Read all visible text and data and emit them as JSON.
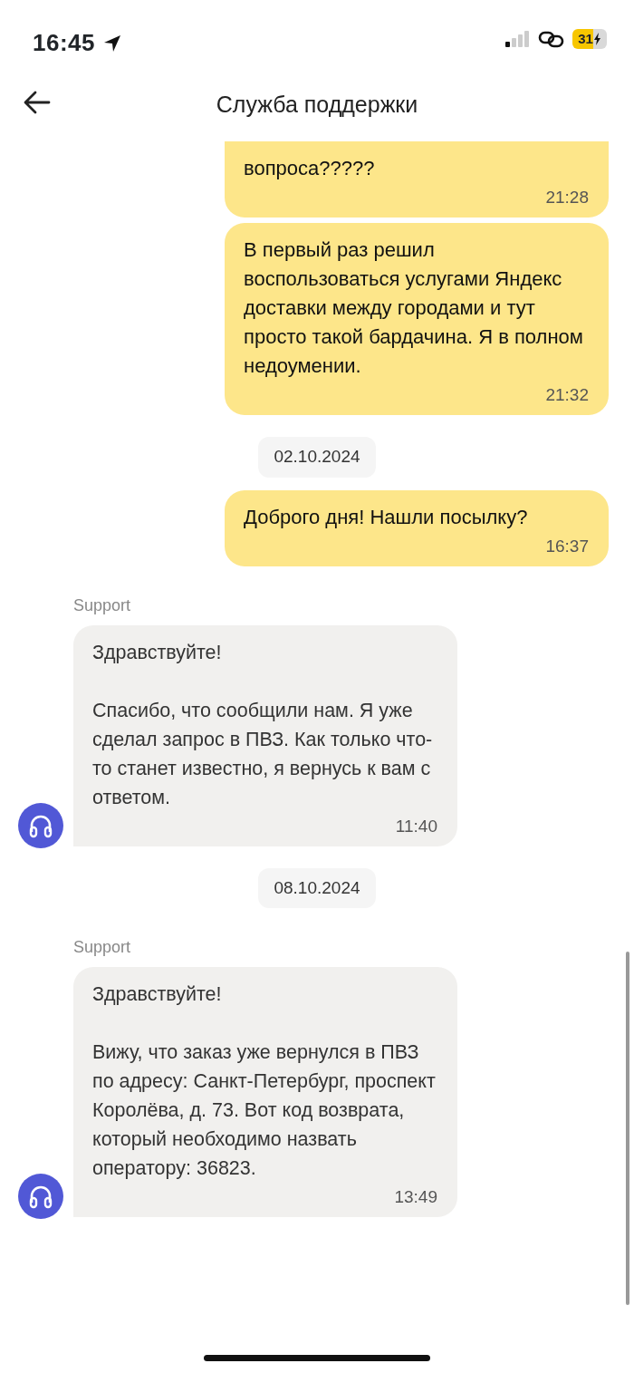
{
  "status_bar": {
    "time": "16:45",
    "battery": "31"
  },
  "header": {
    "title": "Служба поддержки"
  },
  "messages": [
    {
      "kind": "outgoing",
      "text": "вопроса?????",
      "time": "21:28",
      "cut_top": true
    },
    {
      "kind": "outgoing",
      "text": "В первый раз решил воспользоваться услугами Яндекс доставки между городами и тут просто такой бардачина. Я в полном недоумении.",
      "time": "21:32"
    },
    {
      "kind": "date",
      "text": "02.10.2024"
    },
    {
      "kind": "outgoing",
      "text": "Доброго дня! Нашли посылку?",
      "time": "16:37"
    },
    {
      "kind": "incoming",
      "sender": "Support",
      "text": "Здравствуйте!\n\nСпасибо, что сообщили нам. Я уже сделал запрос в ПВЗ. Как только что-то станет известно, я вернусь к вам с ответом.",
      "time": "11:40"
    },
    {
      "kind": "date",
      "text": "08.10.2024"
    },
    {
      "kind": "incoming",
      "sender": "Support",
      "text": "Здравствуйте!\n\nВижу, что заказ уже вернулся в ПВЗ по адресу: Санкт-Петербург, проспект Королёва, д. 73. Вот код возврата, который необходимо назвать оператору: 36823.",
      "time": "13:49"
    }
  ]
}
